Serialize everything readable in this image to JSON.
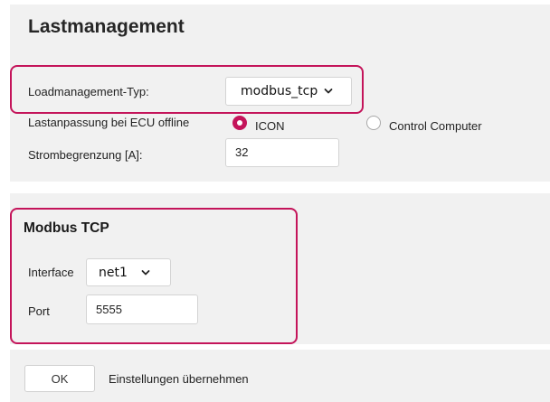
{
  "page": {
    "title": "Lastmanagement"
  },
  "load_mgmt": {
    "type_label": "Loadmanagement-Typ:",
    "type_value": "modbus_tcp",
    "offline_label": "Lastanpassung bei ECU offline",
    "offline_options": [
      {
        "label": "ICON",
        "selected": true
      },
      {
        "label": "Control Computer",
        "selected": false
      }
    ],
    "current_limit_label": "Strombegrenzung [A]:",
    "current_limit_value": "32"
  },
  "modbus": {
    "title": "Modbus TCP",
    "interface_label": "Interface",
    "interface_value": "net1",
    "port_label": "Port",
    "port_value": "5555"
  },
  "footer": {
    "ok_label": "OK",
    "apply_text": "Einstellungen übernehmen"
  },
  "colors": {
    "accent": "#c4145a",
    "band_background": "#f1f1f1"
  },
  "icons": {
    "select_chevron": "chevron-down-icon"
  }
}
